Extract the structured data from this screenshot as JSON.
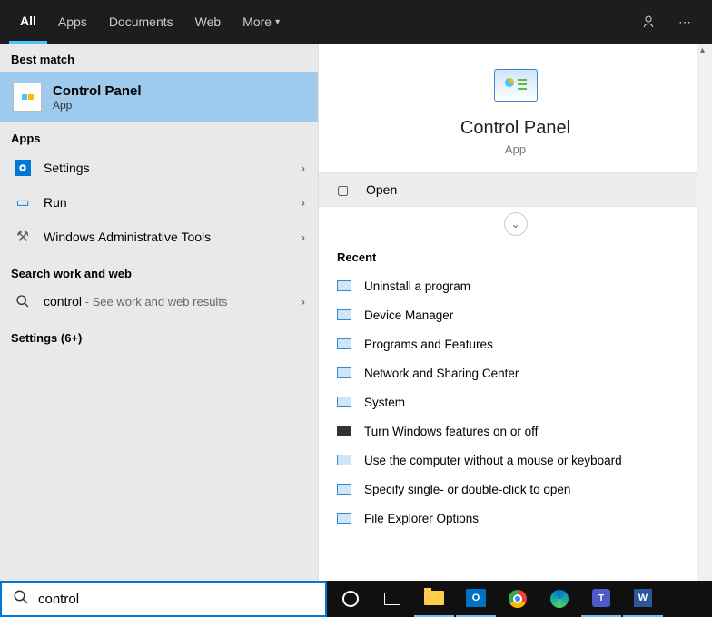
{
  "tabs": {
    "all": "All",
    "apps": "Apps",
    "documents": "Documents",
    "web": "Web",
    "more": "More"
  },
  "sections": {
    "bestmatch": "Best match",
    "apps": "Apps",
    "searchweb": "Search work and web",
    "settings": "Settings (6+)"
  },
  "best": {
    "title": "Control Panel",
    "sub": "App"
  },
  "apps": {
    "settings": "Settings",
    "run": "Run",
    "admin": "Windows Administrative Tools"
  },
  "web": {
    "query": "control",
    "hint": " - See work and web results"
  },
  "detail": {
    "title": "Control Panel",
    "sub": "App",
    "open": "Open",
    "recent": "Recent"
  },
  "recent": [
    "Uninstall a program",
    "Device Manager",
    "Programs and Features",
    "Network and Sharing Center",
    "System",
    "Turn Windows features on or off",
    "Use the computer without a mouse or keyboard",
    "Specify single- or double-click to open",
    "File Explorer Options"
  ],
  "search": {
    "value": "control"
  }
}
